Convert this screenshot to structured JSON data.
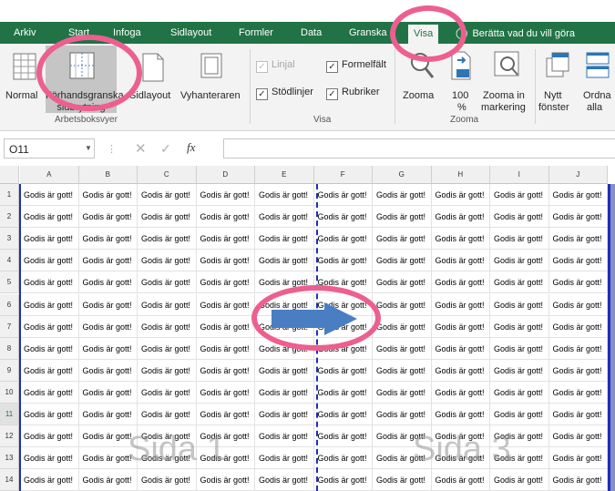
{
  "ribbon_tabs": [
    "Arkiv",
    "Start",
    "Infoga",
    "Sidlayout",
    "Formler",
    "Data",
    "Granska",
    "Visa"
  ],
  "active_tab": "Visa",
  "tell_me": "Berätta vad du vill göra",
  "workbook_views": {
    "normal": "Normal",
    "page_break_preview_line1": "Förhandsgranska",
    "page_break_preview_line2": "sidbrytning",
    "page_layout": "Sidlayout",
    "custom_views": "Vyhanteraren",
    "group_label": "Arbetsboksvyer"
  },
  "show": {
    "ruler": "Linjal",
    "ruler_checked": true,
    "ruler_disabled": true,
    "formula_bar": "Formelfält",
    "formula_bar_checked": true,
    "gridlines": "Stödlinjer",
    "gridlines_checked": true,
    "headings": "Rubriker",
    "headings_checked": true,
    "group_label": "Visa"
  },
  "zoom": {
    "zoom": "Zooma",
    "hundred_line1": "100",
    "hundred_line2": "%",
    "zoom_selection_line1": "Zooma in",
    "zoom_selection_line2": "markering",
    "group_label": "Zooma"
  },
  "window": {
    "new_window_line1": "Nytt",
    "new_window_line2": "fönster",
    "arrange_line1": "Ordna",
    "arrange_line2": "alla"
  },
  "formula_bar": {
    "name_box": "O11",
    "fx": "fx",
    "formula": ""
  },
  "columns": [
    "A",
    "B",
    "C",
    "D",
    "E",
    "F",
    "G",
    "H",
    "I",
    "J"
  ],
  "rows": [
    "1",
    "2",
    "3",
    "4",
    "5",
    "6",
    "7",
    "8",
    "9",
    "10",
    "11",
    "12",
    "13",
    "14"
  ],
  "selected_row": "11",
  "cell_text": "Godis är gott!",
  "page_labels": {
    "left": "Sida 1",
    "right": "Sida 3"
  },
  "colors": {
    "brand_green": "#217346",
    "page_break_blue": "#1f2fb8",
    "annotation_pink": "#ec5f8f",
    "arrow_blue": "#4a7ec3"
  }
}
